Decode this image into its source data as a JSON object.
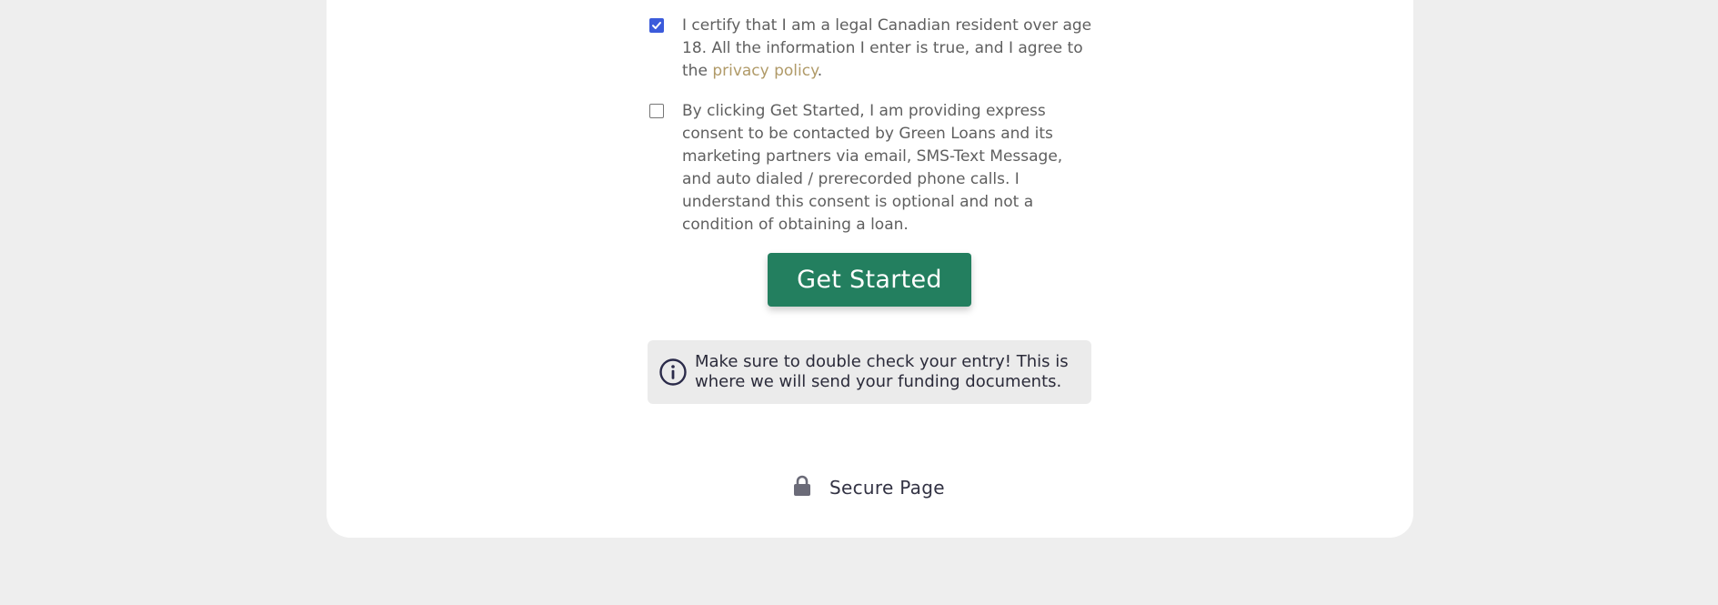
{
  "consents": [
    {
      "checked": true,
      "text_before": "I certify that I am a legal Canadian resident over age 18. All the information I enter is true, and I agree to the ",
      "link_text": "privacy policy",
      "text_after": "."
    },
    {
      "checked": false,
      "text": "By clicking Get Started, I am providing express consent to be contacted by Green Loans and its marketing partners via email, SMS-Text Message, and auto dialed / prerecorded phone calls. I understand this consent is optional and not a condition of obtaining a loan."
    }
  ],
  "cta": {
    "label": "Get Started",
    "color": "#237f5f"
  },
  "notice": {
    "icon": "info-icon",
    "text": "Make sure to double check your entry! This is where we will send your funding documents."
  },
  "footer": {
    "icon": "lock-icon",
    "label": "Secure Page"
  },
  "colors": {
    "background": "#eeeeee",
    "card": "#ffffff",
    "link": "#b09a68",
    "checkbox_checked": "#3b5bdb"
  }
}
